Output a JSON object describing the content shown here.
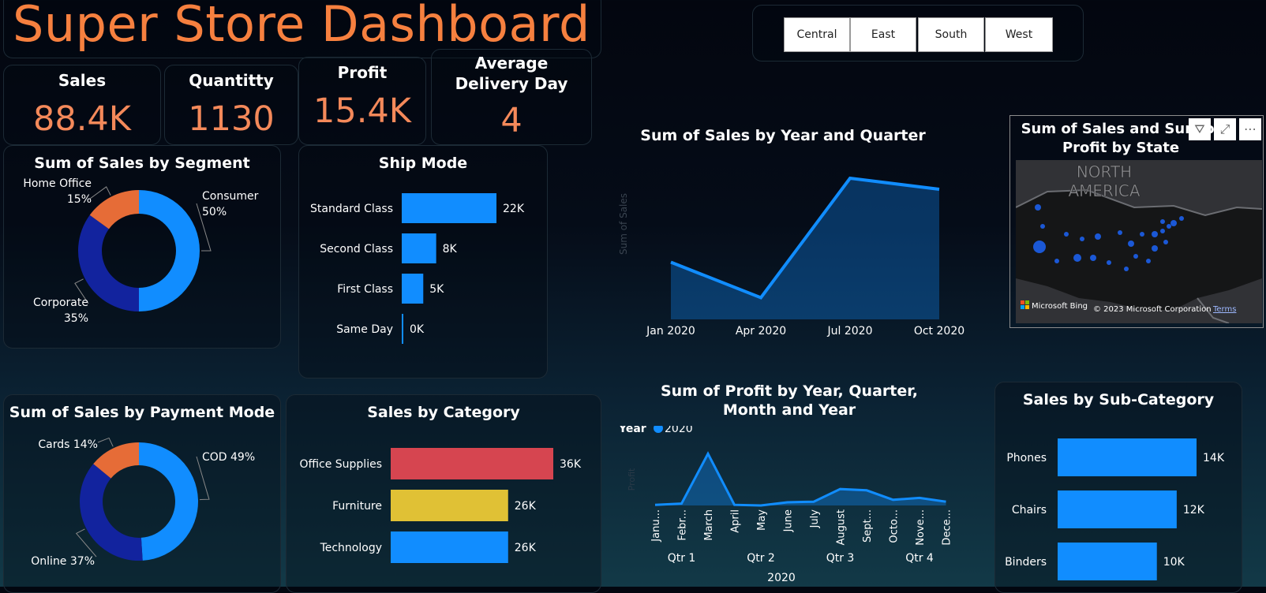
{
  "title": "Super Store Dashboard",
  "region_slicer": [
    "Central",
    "East",
    "South",
    "West"
  ],
  "kpis": [
    {
      "label": "Sales",
      "value": "88.4K"
    },
    {
      "label": "Quantitty",
      "value": "1130"
    },
    {
      "label": "Profit",
      "value": "15.4K"
    },
    {
      "label": "Average Delivery Day",
      "value": "4"
    }
  ],
  "map": {
    "title": "Sum of Sales and Sum of Profit by State",
    "region_label": [
      "NORTH",
      "AMERICA"
    ],
    "bing": "Microsoft Bing",
    "copyright": "© 2023 Microsoft Corporation",
    "terms": "Terms"
  },
  "colors": {
    "blue": "#118dff",
    "navy": "#12239e",
    "orange": "#e66c37",
    "red": "#d64550",
    "yellow": "#e0c135",
    "title": "#f6803f"
  },
  "chart_data": [
    {
      "type": "pie",
      "title": "Sum of Sales by Segment",
      "categories": [
        "Consumer",
        "Corporate",
        "Home Office"
      ],
      "values": [
        50,
        35,
        15
      ],
      "labels": [
        "Consumer\n50%",
        "Corporate\n35%",
        "Home Office\n15%"
      ]
    },
    {
      "type": "bar",
      "title": "Ship Mode",
      "categories": [
        "Standard Class",
        "Second Class",
        "First Class",
        "Same Day"
      ],
      "values": [
        22,
        8,
        5,
        0
      ],
      "data_labels": [
        "22K",
        "8K",
        "5K",
        "0K"
      ]
    },
    {
      "type": "area",
      "title": "Sum of Sales by Year and Quarter",
      "ylabel": "Sum of Sales",
      "categories": [
        "Jan 2020",
        "Apr 2020",
        "Jul 2020",
        "Oct 2020"
      ],
      "values": [
        14.5,
        5.5,
        35.8,
        33
      ]
    },
    {
      "type": "pie",
      "title": "Sum of Sales by Payment Mode",
      "categories": [
        "COD",
        "Online",
        "Cards"
      ],
      "values": [
        49,
        37,
        14
      ],
      "labels": [
        "COD 49%",
        "Online 37%",
        "Cards 14%"
      ]
    },
    {
      "type": "bar",
      "title": "Sales by Category",
      "categories": [
        "Office Supplies",
        "Furniture",
        "Technology"
      ],
      "values": [
        36,
        26,
        26
      ],
      "data_labels": [
        "36K",
        "26K",
        "26K"
      ]
    },
    {
      "type": "area",
      "title": "Sum of Profit by Year, Quarter, Month and Year",
      "legend_title": "Year",
      "series": [
        {
          "name": "2020",
          "values": [
            0.1,
            0.3,
            8.2,
            0.1,
            0,
            0.5,
            0.6,
            2.6,
            2.4,
            0.9,
            1.2,
            0.6
          ]
        }
      ],
      "categories": [
        "Janu...",
        "Febr...",
        "March",
        "April",
        "May",
        "June",
        "July",
        "August",
        "Sept...",
        "Octo...",
        "Nove...",
        "Dece..."
      ],
      "quarters": [
        "Qtr 1",
        "Qtr 2",
        "Qtr 3",
        "Qtr 4"
      ],
      "year_label": "2020",
      "ylabel": "Profit"
    },
    {
      "type": "bar",
      "title": "Sales by Sub-Category",
      "categories": [
        "Phones",
        "Chairs",
        "Binders"
      ],
      "values": [
        14,
        12,
        10
      ],
      "data_labels": [
        "14K",
        "12K",
        "10K"
      ]
    }
  ]
}
